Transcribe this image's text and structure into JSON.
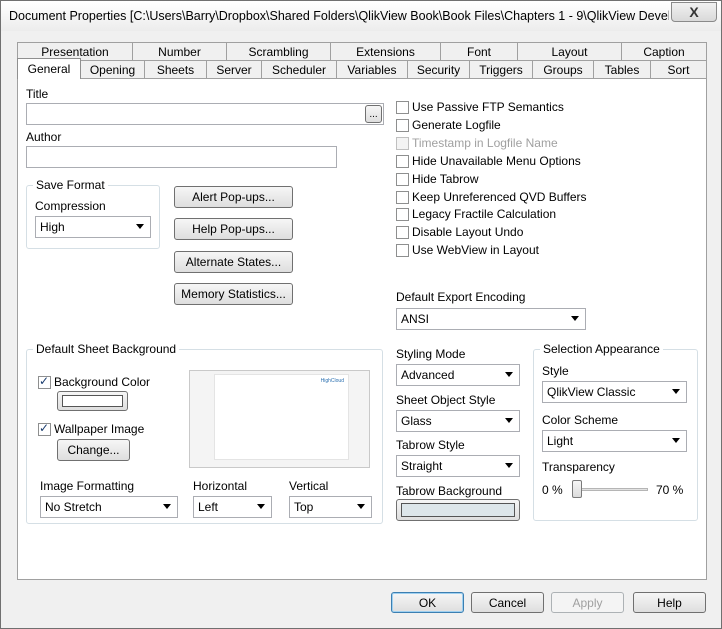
{
  "window": {
    "title": "Document Properties [C:\\Users\\Barry\\Dropbox\\Shared Folders\\QlikView Book\\Book Files\\Chapters 1 - 9\\QlikView Develop...",
    "close_glyph": "X"
  },
  "tabs_row1": [
    "Presentation",
    "Number",
    "Scrambling",
    "Extensions",
    "Font",
    "Layout",
    "Caption"
  ],
  "tabs_row2": [
    "General",
    "Opening",
    "Sheets",
    "Server",
    "Scheduler",
    "Variables",
    "Security",
    "Triggers",
    "Groups",
    "Tables",
    "Sort"
  ],
  "active_tab": "General",
  "general": {
    "title_label": "Title",
    "title_value": "",
    "browse_label": "...",
    "author_label": "Author",
    "author_value": "",
    "save_format": {
      "group_label": "Save Format",
      "compression_label": "Compression",
      "compression_value": "High"
    },
    "buttons": {
      "alert_popups": "Alert Pop-ups...",
      "help_popups": "Help Pop-ups...",
      "alternate_states": "Alternate States...",
      "memory_statistics": "Memory Statistics..."
    },
    "options": [
      {
        "label": "Use Passive FTP Semantics",
        "checked": false,
        "disabled": false
      },
      {
        "label": "Generate Logfile",
        "checked": false,
        "disabled": false
      },
      {
        "label": "Timestamp in Logfile Name",
        "checked": false,
        "disabled": true
      },
      {
        "label": "Hide Unavailable Menu Options",
        "checked": false,
        "disabled": false
      },
      {
        "label": "Hide Tabrow",
        "checked": false,
        "disabled": false
      },
      {
        "label": "Keep Unreferenced QVD Buffers",
        "checked": false,
        "disabled": false
      },
      {
        "label": "Legacy Fractile Calculation",
        "checked": false,
        "disabled": false
      },
      {
        "label": "Disable Layout Undo",
        "checked": false,
        "disabled": false
      },
      {
        "label": "Use WebView in Layout",
        "checked": false,
        "disabled": false
      }
    ],
    "export_encoding": {
      "label": "Default Export Encoding",
      "value": "ANSI"
    },
    "sheet_background": {
      "group_label": "Default Sheet Background",
      "background_color_label": "Background Color",
      "background_color_checked": true,
      "wallpaper_label": "Wallpaper Image",
      "wallpaper_checked": true,
      "change_label": "Change...",
      "preview_logo": "HighCloud",
      "image_formatting_label": "Image Formatting",
      "image_formatting_value": "No Stretch",
      "horizontal_label": "Horizontal",
      "horizontal_value": "Left",
      "vertical_label": "Vertical",
      "vertical_value": "Top"
    },
    "styling": {
      "styling_mode_label": "Styling Mode",
      "styling_mode_value": "Advanced",
      "sheet_object_style_label": "Sheet Object Style",
      "sheet_object_style_value": "Glass",
      "tabrow_style_label": "Tabrow Style",
      "tabrow_style_value": "Straight",
      "tabrow_background_label": "Tabrow Background",
      "tabrow_background_color": "#dde6ea"
    },
    "selection_appearance": {
      "group_label": "Selection Appearance",
      "style_label": "Style",
      "style_value": "QlikView Classic",
      "color_scheme_label": "Color Scheme",
      "color_scheme_value": "Light",
      "transparency_label": "Transparency",
      "min_label": "0 %",
      "max_label": "70 %",
      "transparency_value_fraction": 0.0
    }
  },
  "footer": {
    "ok": "OK",
    "cancel": "Cancel",
    "apply": "Apply",
    "help": "Help"
  }
}
